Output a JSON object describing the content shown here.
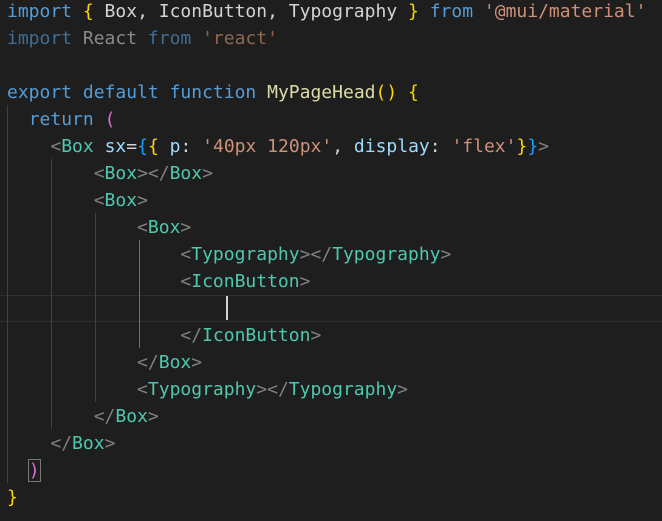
{
  "editor": {
    "lines": [
      [
        {
          "t": "import",
          "c": "kw"
        },
        {
          "t": " ",
          "c": "p"
        },
        {
          "t": "{",
          "c": "br1"
        },
        {
          "t": " Box, IconButton, Typography ",
          "c": "id"
        },
        {
          "t": "}",
          "c": "br1"
        },
        {
          "t": " ",
          "c": "p"
        },
        {
          "t": "from",
          "c": "kw"
        },
        {
          "t": " ",
          "c": "p"
        },
        {
          "t": "'@mui/material'",
          "c": "str"
        }
      ],
      [
        {
          "t": "import",
          "c": "kwdim"
        },
        {
          "t": " React ",
          "c": "iddim"
        },
        {
          "t": "from",
          "c": "kwdim"
        },
        {
          "t": " ",
          "c": "p"
        },
        {
          "t": "'react'",
          "c": "strdim"
        }
      ],
      [],
      [
        {
          "t": "export",
          "c": "kw"
        },
        {
          "t": " ",
          "c": "p"
        },
        {
          "t": "default",
          "c": "kw"
        },
        {
          "t": " ",
          "c": "p"
        },
        {
          "t": "function",
          "c": "kw"
        },
        {
          "t": " ",
          "c": "p"
        },
        {
          "t": "MyPageHead",
          "c": "fn"
        },
        {
          "t": "()",
          "c": "br1"
        },
        {
          "t": " ",
          "c": "p"
        },
        {
          "t": "{",
          "c": "br1"
        }
      ],
      [
        {
          "t": "  ",
          "c": "p"
        },
        {
          "t": "return",
          "c": "kw2"
        },
        {
          "t": " ",
          "c": "p"
        },
        {
          "t": "(",
          "c": "br2"
        }
      ],
      [
        {
          "t": "    ",
          "c": "p"
        },
        {
          "t": "<",
          "c": "tagp"
        },
        {
          "t": "Box",
          "c": "tag"
        },
        {
          "t": " ",
          "c": "p"
        },
        {
          "t": "sx",
          "c": "attr"
        },
        {
          "t": "=",
          "c": "id"
        },
        {
          "t": "{",
          "c": "br3"
        },
        {
          "t": "{",
          "c": "br1"
        },
        {
          "t": " ",
          "c": "p"
        },
        {
          "t": "p",
          "c": "attr"
        },
        {
          "t": ": ",
          "c": "id"
        },
        {
          "t": "'40px 120px'",
          "c": "str"
        },
        {
          "t": ", ",
          "c": "id"
        },
        {
          "t": "display",
          "c": "attr"
        },
        {
          "t": ": ",
          "c": "id"
        },
        {
          "t": "'flex'",
          "c": "str"
        },
        {
          "t": "}",
          "c": "br1"
        },
        {
          "t": "}",
          "c": "br3"
        },
        {
          "t": ">",
          "c": "tagp"
        }
      ],
      [
        {
          "t": "        ",
          "c": "p"
        },
        {
          "t": "<",
          "c": "tagp"
        },
        {
          "t": "Box",
          "c": "tag"
        },
        {
          "t": "></",
          "c": "tagp"
        },
        {
          "t": "Box",
          "c": "tag"
        },
        {
          "t": ">",
          "c": "tagp"
        }
      ],
      [
        {
          "t": "        ",
          "c": "p"
        },
        {
          "t": "<",
          "c": "tagp"
        },
        {
          "t": "Box",
          "c": "tag"
        },
        {
          "t": ">",
          "c": "tagp"
        }
      ],
      [
        {
          "t": "            ",
          "c": "p"
        },
        {
          "t": "<",
          "c": "tagp"
        },
        {
          "t": "Box",
          "c": "tag"
        },
        {
          "t": ">",
          "c": "tagp"
        }
      ],
      [
        {
          "t": "                ",
          "c": "p"
        },
        {
          "t": "<",
          "c": "tagp"
        },
        {
          "t": "Typography",
          "c": "tag"
        },
        {
          "t": "></",
          "c": "tagp"
        },
        {
          "t": "Typography",
          "c": "tag"
        },
        {
          "t": ">",
          "c": "tagp"
        }
      ],
      [
        {
          "t": "                ",
          "c": "p"
        },
        {
          "t": "<",
          "c": "tagp"
        },
        {
          "t": "IconButton",
          "c": "tag"
        },
        {
          "t": ">",
          "c": "tagp"
        }
      ],
      [],
      [
        {
          "t": "                ",
          "c": "p"
        },
        {
          "t": "</",
          "c": "tagp"
        },
        {
          "t": "IconButton",
          "c": "tag"
        },
        {
          "t": ">",
          "c": "tagp"
        }
      ],
      [
        {
          "t": "            ",
          "c": "p"
        },
        {
          "t": "</",
          "c": "tagp"
        },
        {
          "t": "Box",
          "c": "tag"
        },
        {
          "t": ">",
          "c": "tagp"
        }
      ],
      [
        {
          "t": "            ",
          "c": "p"
        },
        {
          "t": "<",
          "c": "tagp"
        },
        {
          "t": "Typography",
          "c": "tag"
        },
        {
          "t": "></",
          "c": "tagp"
        },
        {
          "t": "Typography",
          "c": "tag"
        },
        {
          "t": ">",
          "c": "tagp"
        }
      ],
      [
        {
          "t": "        ",
          "c": "p"
        },
        {
          "t": "</",
          "c": "tagp"
        },
        {
          "t": "Box",
          "c": "tag"
        },
        {
          "t": ">",
          "c": "tagp"
        }
      ],
      [
        {
          "t": "    ",
          "c": "p"
        },
        {
          "t": "</",
          "c": "tagp"
        },
        {
          "t": "Box",
          "c": "tag"
        },
        {
          "t": ">",
          "c": "tagp"
        }
      ],
      [
        {
          "t": "  ",
          "c": "p"
        },
        {
          "t": ")",
          "c": "br2m"
        }
      ],
      [
        {
          "t": "}",
          "c": "br1"
        }
      ]
    ],
    "current_line": 11
  },
  "colors": {
    "kw": "#569cd6",
    "kw2": "#569cd6",
    "kwdim": "#3f6d94",
    "id": "#d4d4d4",
    "iddim": "#8a8a8a",
    "str": "#ce9178",
    "strdim": "#8f6753",
    "fn": "#dcdcaa",
    "br1": "#ffd700",
    "br2": "#da70d6",
    "br2m": "#da70d6",
    "br3": "#179fff",
    "tag": "#4ec9b0",
    "tagp": "#808080",
    "attr": "#9cdcfe",
    "p": "#d4d4d4"
  }
}
